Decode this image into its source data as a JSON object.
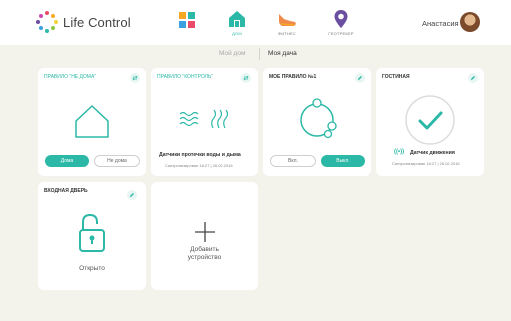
{
  "header": {
    "brand": "Life Control",
    "nav": [
      {
        "label": ""
      },
      {
        "label": "ДОМ"
      },
      {
        "label": "ФИТНЕС"
      },
      {
        "label": "ГЕОТРЕКЕР"
      }
    ],
    "user_name": "Анастасия"
  },
  "subnav": {
    "inactive": "Мой дом",
    "active": "Моя дача"
  },
  "cards": {
    "rule_not_home": {
      "title": "ПРАВИЛО \"НЕ ДОМА\"",
      "btn_home": "Дома",
      "btn_away": "Не дома"
    },
    "rule_control": {
      "title": "ПРАВИЛО \"КОНТРОЛЬ\"",
      "sensor": "Датчики протечки воды и дыма",
      "sync": "Синхронизирован 16:27 | 26.02.2016"
    },
    "my_rule": {
      "title": "МОЕ ПРАВИЛО №1",
      "btn_off": "Вкл.",
      "btn_on": "Выкл."
    },
    "living_room": {
      "title": "ГОСТИНАЯ",
      "sensor": "Датчик движения",
      "sync": "Синхронизирован 16:27 | 26.02.2016"
    },
    "front_door": {
      "title": "ВХОДНАЯ ДВЕРЬ",
      "state": "Открыто"
    },
    "add_device": {
      "label": "Добавить устройство"
    }
  },
  "colors": {
    "accent": "#2bb8a6",
    "background": "#f3f2eb",
    "pin": "#6a4fa0",
    "shoe": "#f08a4b"
  }
}
